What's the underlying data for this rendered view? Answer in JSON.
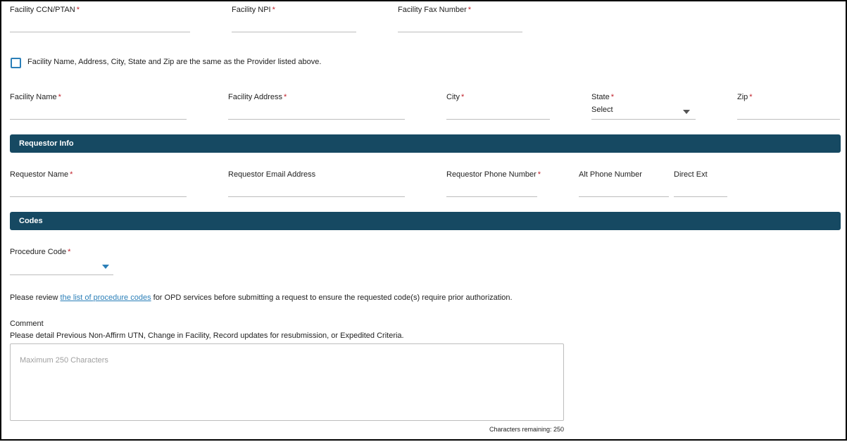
{
  "facility": {
    "ccn_label": "Facility CCN/PTAN",
    "npi_label": "Facility NPI",
    "fax_label": "Facility Fax Number",
    "same_as_provider_label": "Facility Name, Address, City, State and Zip are the same as the Provider listed above.",
    "name_label": "Facility Name",
    "address_label": "Facility Address",
    "city_label": "City",
    "state_label": "State",
    "state_value": "Select",
    "zip_label": "Zip"
  },
  "required_marker": "*",
  "requestor": {
    "section_title": "Requestor Info",
    "name_label": "Requestor Name",
    "email_label": "Requestor Email Address",
    "phone_label": "Requestor Phone Number",
    "alt_phone_label": "Alt Phone Number",
    "ext_label": "Direct Ext"
  },
  "codes": {
    "section_title": "Codes",
    "procedure_label": "Procedure Code",
    "review_prefix": "Please review ",
    "review_link": "the list of procedure codes",
    "review_suffix": " for OPD services before submitting a request to ensure the requested code(s) require prior authorization."
  },
  "comment": {
    "label": "Comment",
    "hint": "Please detail Previous Non-Affirm UTN, Change in Facility, Record updates for resubmission, or Expedited Criteria.",
    "placeholder": "Maximum 250 Characters",
    "remaining": "Characters remaining: 250"
  },
  "colors": {
    "section_bar": "#164962",
    "required": "#c0202a",
    "link": "#2b7fb8"
  }
}
